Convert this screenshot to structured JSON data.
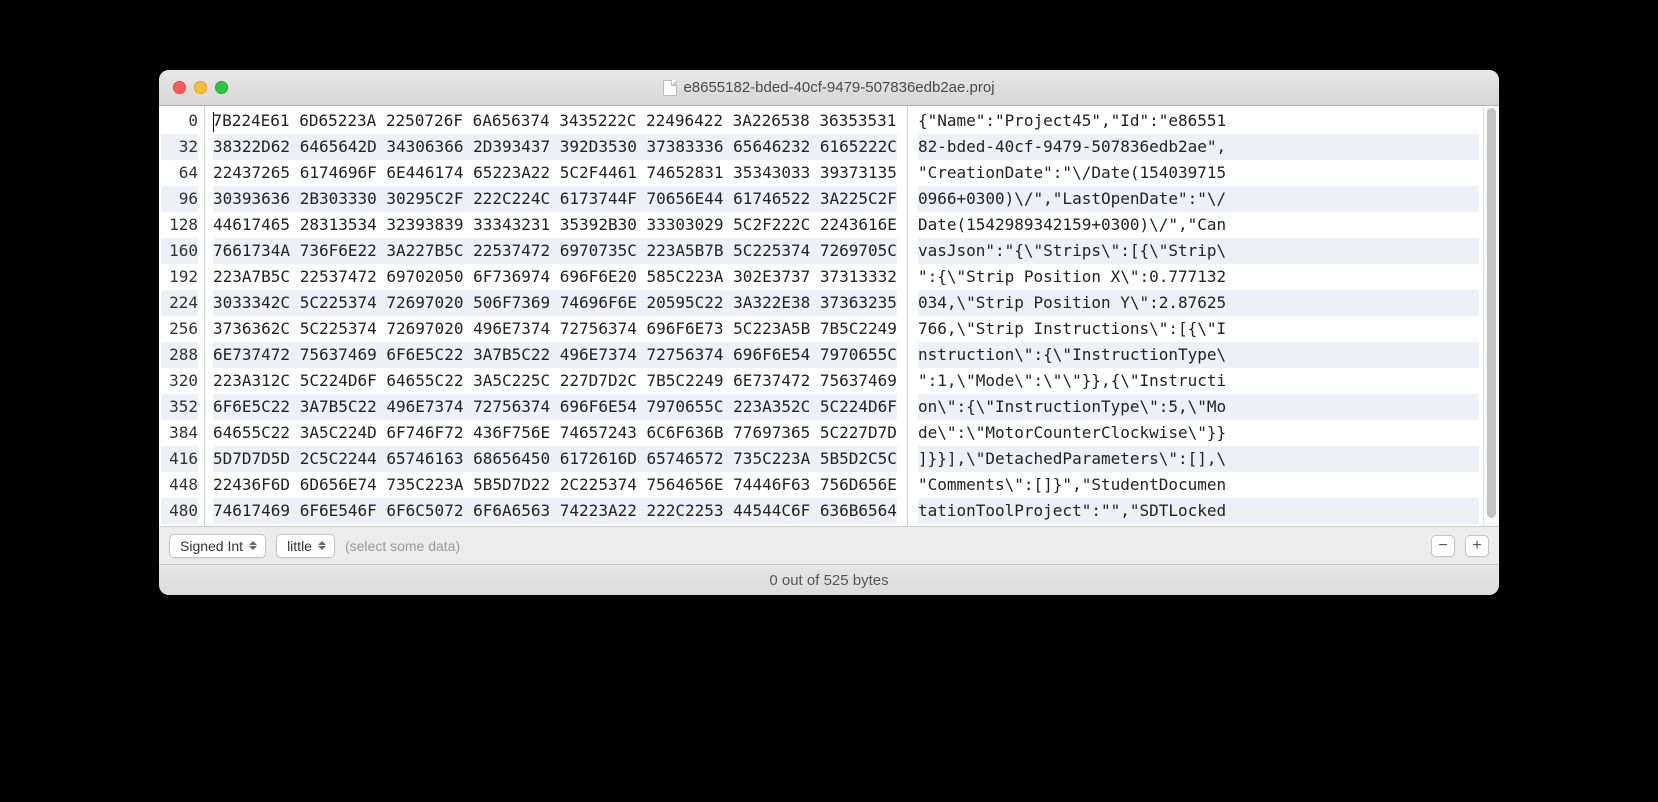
{
  "window": {
    "title": "e8655182-bded-40cf-9479-507836edb2ae.proj"
  },
  "offsets": [
    "0",
    "32",
    "64",
    "96",
    "128",
    "160",
    "192",
    "224",
    "256",
    "288",
    "320",
    "352",
    "384",
    "416",
    "448",
    "480"
  ],
  "hex": [
    "7B224E61 6D65223A 2250726F 6A656374 3435222C 22496422 3A226538 36353531",
    "38322D62 6465642D 34306366 2D393437 392D3530 37383336 65646232 6165222C",
    "22437265 6174696F 6E446174 65223A22 5C2F4461 74652831 35343033 39373135",
    "30393636 2B303330 30295C2F 222C224C 6173744F 70656E44 61746522 3A225C2F",
    "44617465 28313534 32393839 33343231 35392B30 33303029 5C2F222C 2243616E",
    "7661734A 736F6E22 3A227B5C 22537472 6970735C 223A5B7B 5C225374 7269705C",
    "223A7B5C 22537472 69702050 6F736974 696F6E20 585C223A 302E3737 37313332",
    "3033342C 5C225374 72697020 506F7369 74696F6E 20595C22 3A322E38 37363235",
    "3736362C 5C225374 72697020 496E7374 72756374 696F6E73 5C223A5B 7B5C2249",
    "6E737472 75637469 6F6E5C22 3A7B5C22 496E7374 72756374 696F6E54 7970655C",
    "223A312C 5C224D6F 64655C22 3A5C225C 227D7D2C 7B5C2249 6E737472 75637469",
    "6F6E5C22 3A7B5C22 496E7374 72756374 696F6E54 7970655C 223A352C 5C224D6F",
    "64655C22 3A5C224D 6F746F72 436F756E 74657243 6C6F636B 77697365 5C227D7D",
    "5D7D7D5D 2C5C2244 65746163 68656450 6172616D 65746572 735C223A 5B5D2C5C",
    "22436F6D 6D656E74 735C223A 5B5D7D22 2C225374 7564656E 74446F63 756D656E",
    "74617469 6F6E546F 6F6C5072 6F6A6563 74223A22 222C2253 44544C6F 636B6564"
  ],
  "ascii": [
    "{\"Name\":\"Project45\",\"Id\":\"e86551",
    "82-bded-40cf-9479-507836edb2ae\",",
    "\"CreationDate\":\"\\/Date(154039715",
    "0966+0300)\\/\",\"LastOpenDate\":\"\\/",
    "Date(1542989342159+0300)\\/\",\"Can",
    "vasJson\":\"{\\\"Strips\\\":[{\\\"Strip\\",
    "\":{\\\"Strip Position X\\\":0.777132",
    "034,\\\"Strip Position Y\\\":2.87625",
    "766,\\\"Strip Instructions\\\":[{\\\"I",
    "nstruction\\\":{\\\"InstructionType\\",
    "\":1,\\\"Mode\\\":\\\"\\\"}},{\\\"Instructi",
    "on\\\":{\\\"InstructionType\\\":5,\\\"Mo",
    "de\\\":\\\"MotorCounterClockwise\\\"}}",
    "]}}],\\\"DetachedParameters\\\":[],\\",
    "\"Comments\\\":[]}\",\"StudentDocumen",
    "tationToolProject\":\"\",\"SDTLocked"
  ],
  "toolbar": {
    "format_select": "Signed Int",
    "endian_select": "little",
    "placeholder": "(select some data)"
  },
  "status": "0 out of 525 bytes"
}
